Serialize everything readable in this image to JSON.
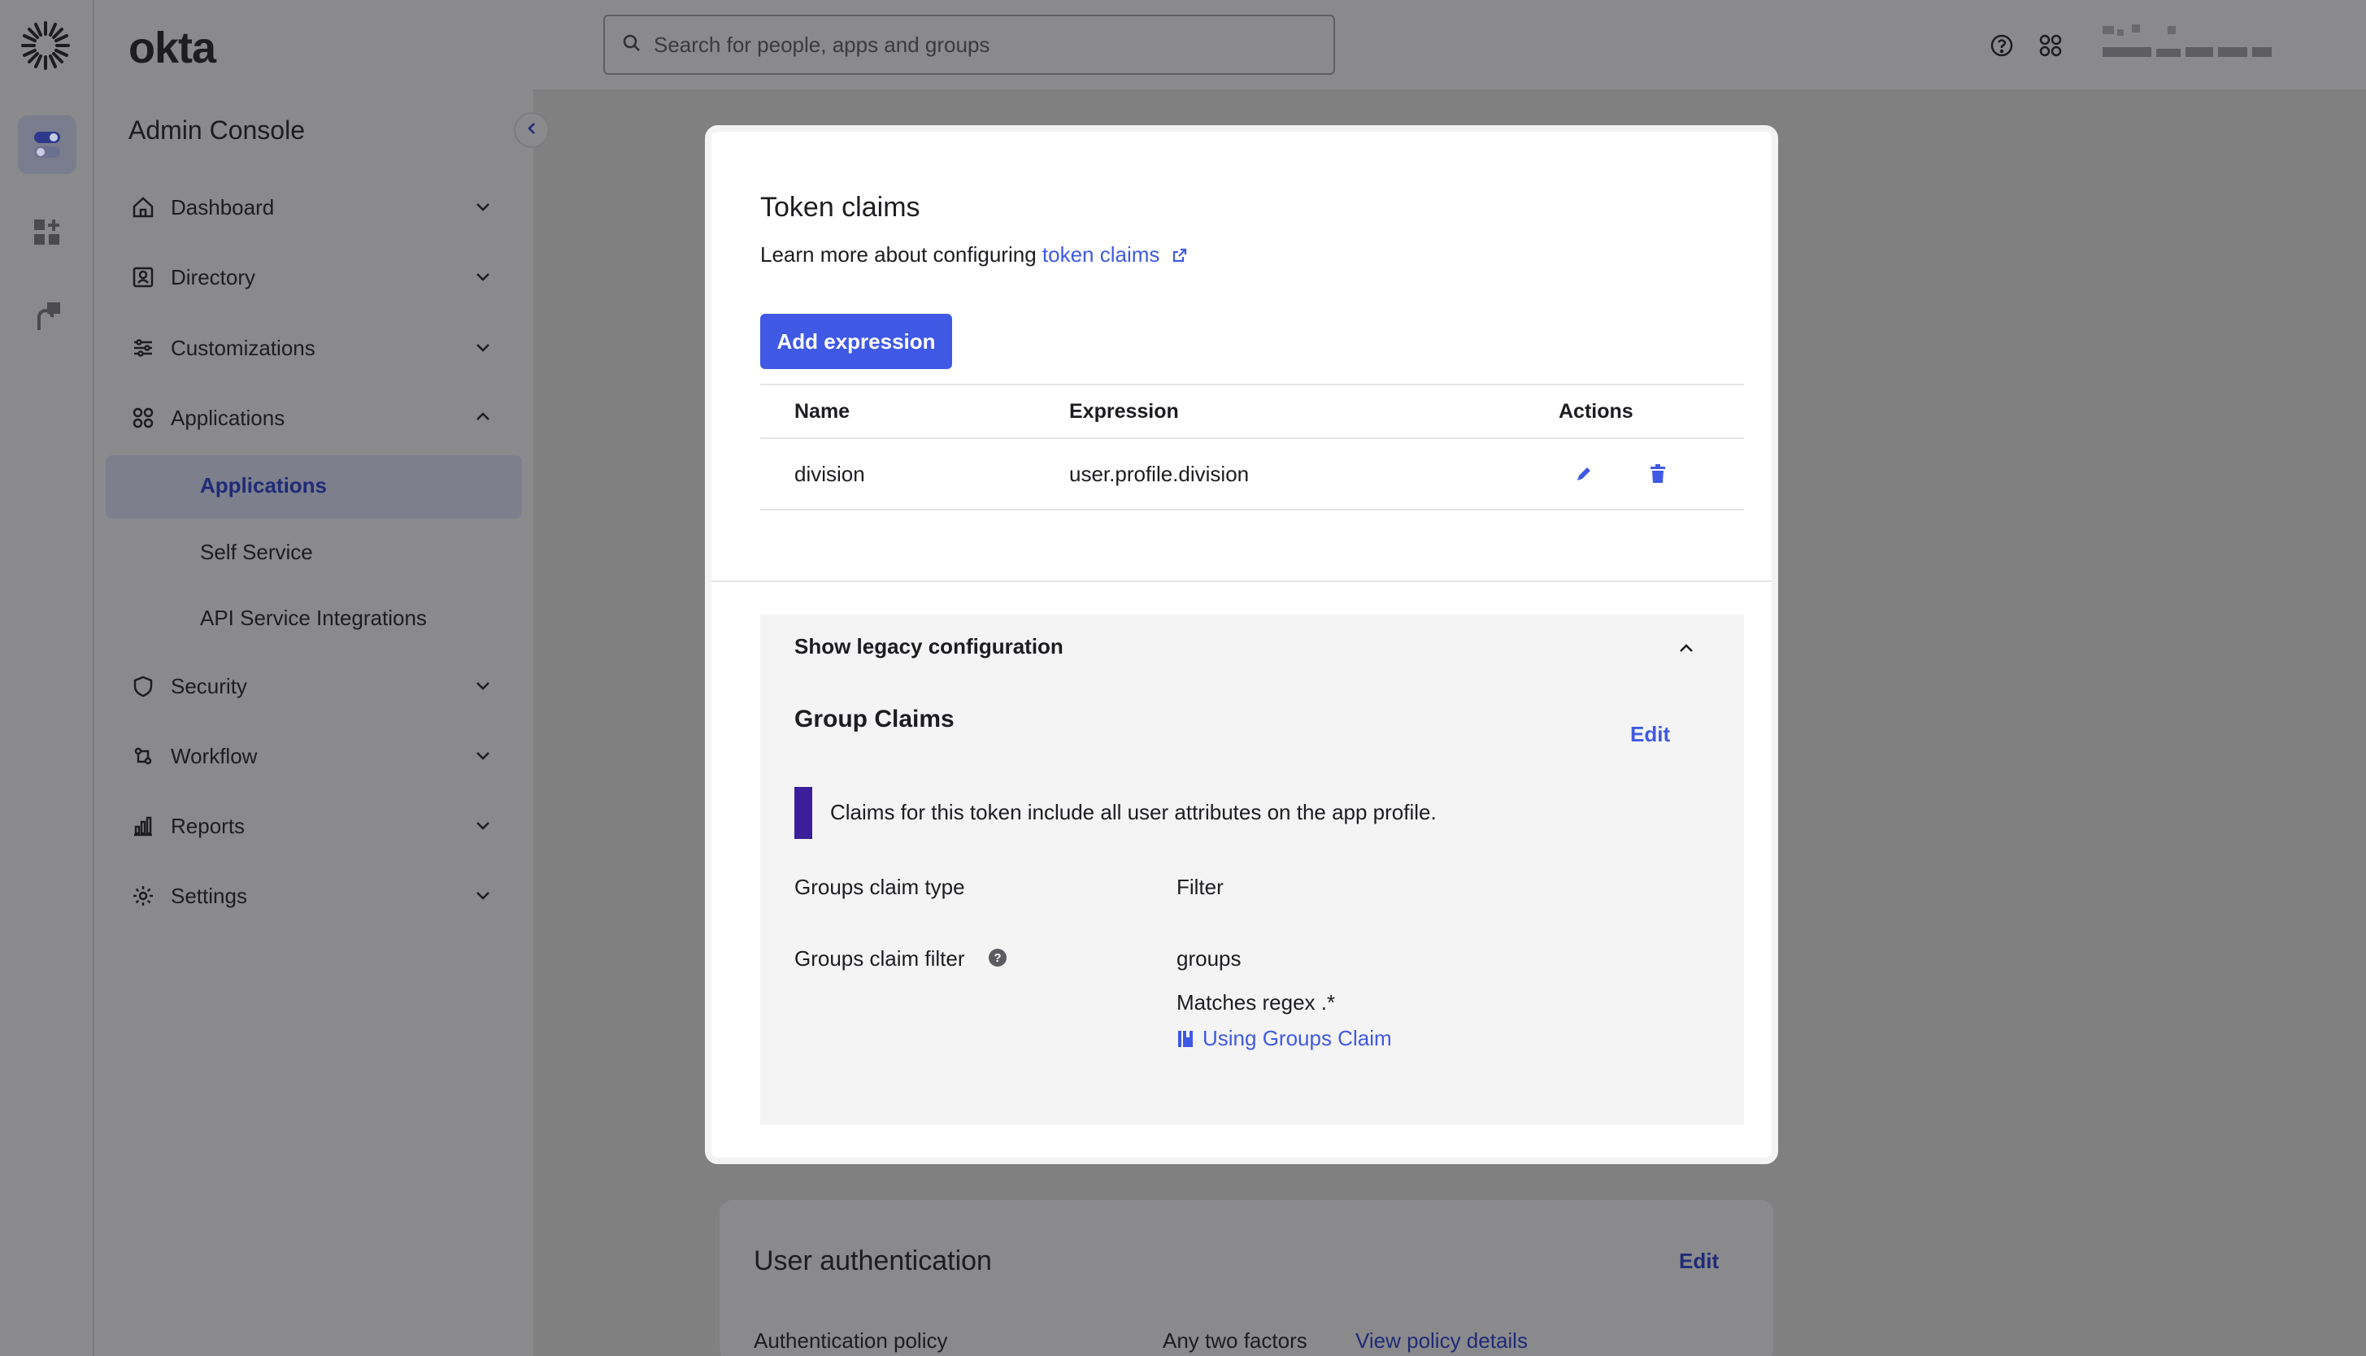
{
  "app": {
    "brand": "okta",
    "console_title": "Admin Console"
  },
  "search": {
    "placeholder": "Search for people, apps and groups"
  },
  "sidebar": {
    "items": [
      {
        "label": "Dashboard",
        "icon": "home-icon",
        "expanded": false
      },
      {
        "label": "Directory",
        "icon": "directory-icon",
        "expanded": false
      },
      {
        "label": "Customizations",
        "icon": "sliders-icon",
        "expanded": false
      },
      {
        "label": "Applications",
        "icon": "apps-grid-icon",
        "expanded": true
      },
      {
        "label": "Security",
        "icon": "shield-icon",
        "expanded": false
      },
      {
        "label": "Workflow",
        "icon": "workflow-icon",
        "expanded": false
      },
      {
        "label": "Reports",
        "icon": "reports-icon",
        "expanded": false
      },
      {
        "label": "Settings",
        "icon": "gear-icon",
        "expanded": false
      }
    ],
    "sub_items": [
      {
        "label": "Applications",
        "active": true
      },
      {
        "label": "Self Service",
        "active": false
      },
      {
        "label": "API Service Integrations",
        "active": false
      }
    ]
  },
  "modal": {
    "title": "Token claims",
    "learn_prefix": "Learn more about configuring ",
    "learn_link": "token claims",
    "add_button": "Add expression",
    "table": {
      "headers": [
        "Name",
        "Expression",
        "Actions"
      ],
      "rows": [
        {
          "name": "division",
          "expression": "user.profile.division"
        }
      ]
    },
    "legacy": {
      "header": "Show legacy configuration",
      "group_claims_title": "Group Claims",
      "edit_label": "Edit",
      "callout": "Claims for this token include all user attributes on the app profile.",
      "groups_claim_type_label": "Groups claim type",
      "groups_claim_type_value": "Filter",
      "groups_claim_filter_label": "Groups claim filter",
      "groups_claim_filter_value": "groups",
      "matches": "Matches regex .*",
      "help_link": "Using Groups Claim"
    }
  },
  "background_card": {
    "title": "User authentication",
    "edit_label": "Edit",
    "policy_label": "Authentication policy",
    "policy_value": "Any two factors",
    "policy_link": "View policy details"
  },
  "colors": {
    "accent": "#3f59e4",
    "callout_bar": "#3b1f9a",
    "overlay": "#808080"
  }
}
